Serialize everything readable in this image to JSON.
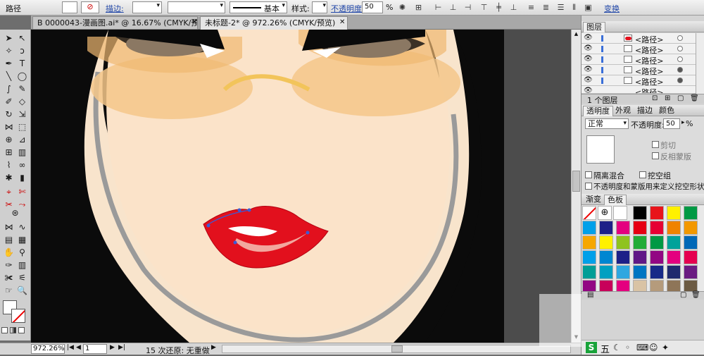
{
  "control_bar": {
    "object_type": "路径",
    "stroke_label": "描边:",
    "stroke_profile": "基本",
    "style_label": "样式:",
    "opacity_label": "不透明度:",
    "opacity_value": "50",
    "opacity_unit": "%",
    "transform_label": "变换"
  },
  "tabs": [
    {
      "label": "B 0000043-漫画图.ai* @ 16.67% (CMYK/预览)"
    },
    {
      "label": "未标题-2* @ 972.26% (CMYK/预览)"
    }
  ],
  "status": {
    "zoom": "972.26%",
    "page": "1",
    "history": "15 次还原: 无重做"
  },
  "layers_panel": {
    "title": "图层",
    "rows": [
      {
        "name": "<路径>"
      },
      {
        "name": "<路径>"
      },
      {
        "name": "<路径>"
      },
      {
        "name": "<路径>"
      },
      {
        "name": "<路径>"
      },
      {
        "name": "<路径>"
      }
    ],
    "footer": "1 个图层"
  },
  "transparency_panel": {
    "tabs": [
      "透明度",
      "外观",
      "描边",
      "颜色"
    ],
    "blend_mode": "正常",
    "opacity_label": "不透明度:",
    "opacity_value": "50",
    "opacity_unit": "%",
    "clip_label": "剪切",
    "invert_mask_label": "反相蒙版",
    "isolate_blend_label": "隔离混合",
    "knockout_group_label": "挖空组",
    "opacity_mask_label": "不透明度和蒙版用来定义挖空形状"
  },
  "swatches_panel": {
    "tabs": [
      "渐变",
      "色板"
    ],
    "colors": [
      "#000000",
      "#e8141b",
      "#fff100",
      "#009944",
      "#00a0e9",
      "#1d2088",
      "#e4007f",
      "#e60012",
      "#e60033",
      "#f08300",
      "#f39800",
      "#f6a700",
      "#fff100",
      "#8fc31f",
      "#22ac38",
      "#009944",
      "#00a29a",
      "#0068b7",
      "#00a0e9",
      "#0086d1",
      "#1d2088",
      "#601986",
      "#920783",
      "#e4007f",
      "#e5004f",
      "#009e96",
      "#00a0c1",
      "#2ea7e0",
      "#0075c2",
      "#172a88",
      "#1f2a6e",
      "#6a1b81",
      "#920783",
      "#c8005a",
      "#e4007f",
      "#d9c3a5",
      "#b59b7c",
      "#8e7558",
      "#6b5a43"
    ]
  },
  "ime_bar": {
    "label": "五"
  }
}
